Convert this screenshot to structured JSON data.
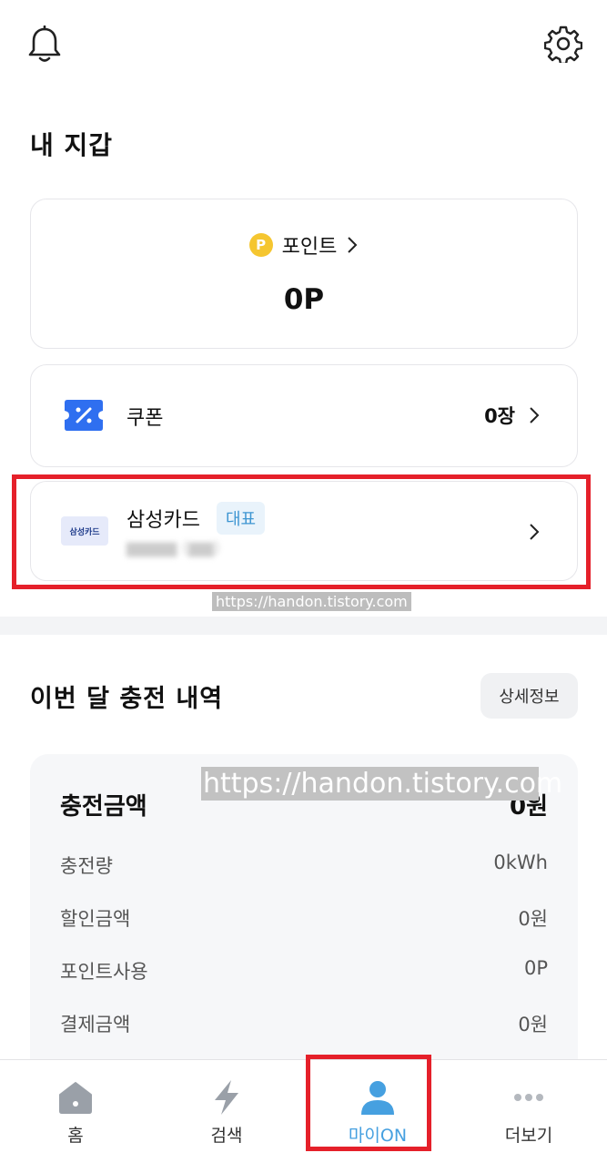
{
  "wallet": {
    "title": "내 지갑",
    "points": {
      "label": "포인트",
      "coin": "P",
      "value": "0P"
    },
    "coupon": {
      "label": "쿠폰",
      "count": "0장"
    },
    "card": {
      "logo_text": "삼성카드",
      "name": "삼성카드",
      "badge": "대표"
    }
  },
  "watermark": {
    "small": "https://handon.tistory.com",
    "large": "https://handon.tistory.com"
  },
  "charge": {
    "title": "이번 달 충전 내역",
    "detail_button": "상세정보",
    "total_label": "충전금액",
    "total_value": "0원",
    "rows": [
      {
        "label": "충전량",
        "value": "0kWh"
      },
      {
        "label": "할인금액",
        "value": "0원"
      },
      {
        "label": "포인트사용",
        "value": "0P"
      },
      {
        "label": "결제금액",
        "value": "0원"
      }
    ]
  },
  "nav": {
    "items": [
      {
        "label": "홈",
        "icon": "home-icon"
      },
      {
        "label": "검색",
        "icon": "bolt-icon"
      },
      {
        "label": "마이ON",
        "icon": "person-icon",
        "active": true
      },
      {
        "label": "더보기",
        "icon": "more-icon"
      }
    ]
  },
  "colors": {
    "accent": "#46a0e0",
    "highlight": "#e5202a",
    "coin": "#f5c630",
    "coupon": "#2f6ff0"
  }
}
